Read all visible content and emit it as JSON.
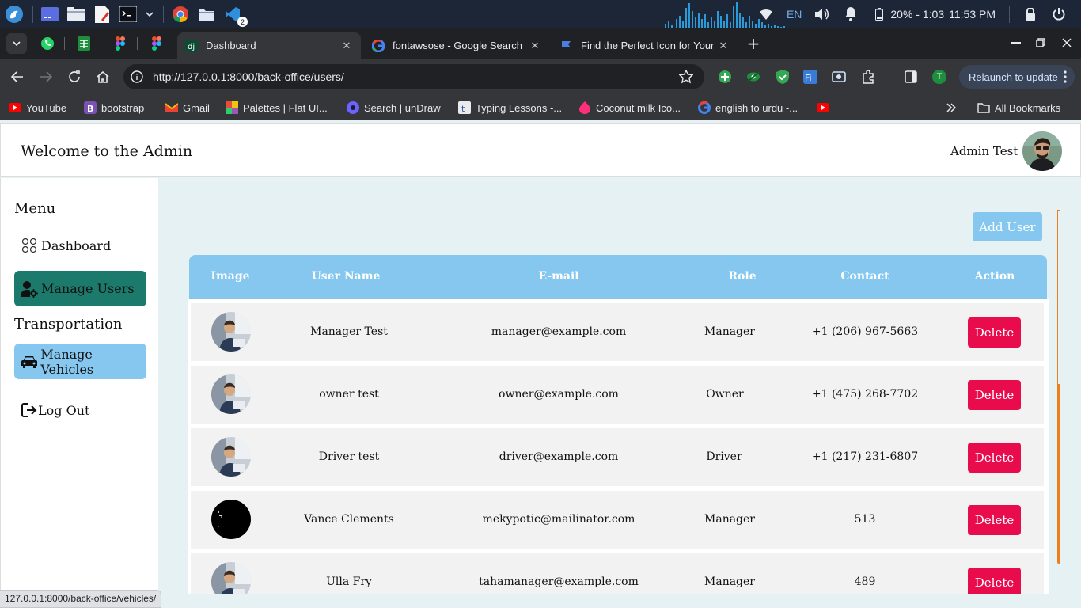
{
  "taskbar": {
    "badge": "2",
    "language": "EN",
    "battery_time": "20% - 1:03",
    "clock": "11:53 PM"
  },
  "browser": {
    "tabs": [
      {
        "title": "Dashboard",
        "active": true
      },
      {
        "title": "fontawsose - Google Search",
        "active": false
      },
      {
        "title": "Find the Perfect Icon for Your",
        "active": false
      }
    ],
    "url": "http://127.0.0.1:8000/back-office/users/",
    "relaunch_label": "Relaunch to update",
    "profile_initial": "T",
    "bookmarks": [
      "YouTube",
      "bootstrap",
      "Gmail",
      "Palettes | Flat UI...",
      "Search | unDraw",
      "Typing Lessons -...",
      "Coconut milk Ico...",
      "english to urdu -..."
    ],
    "all_bookmarks": "All Bookmarks",
    "status_url": "127.0.0.1:8000/back-office/vehicles/"
  },
  "header": {
    "welcome": "Welcome to the Admin",
    "admin_name": "Admin Test"
  },
  "sidebar": {
    "menu_heading": "Menu",
    "dashboard": "Dashboard",
    "manage_users": "Manage Users",
    "transport_heading": "Transportation",
    "manage_vehicles": "Manage Vehicles",
    "logout": "Log Out"
  },
  "main": {
    "add_user": "Add User",
    "columns": [
      "Image",
      "User Name",
      "E-mail",
      "Role",
      "Contact",
      "Action"
    ],
    "delete_label": "Delete",
    "rows": [
      {
        "name": "Manager Test",
        "email": "manager@example.com",
        "role": "Manager",
        "contact": "+1 (206) 967-5663",
        "avatar": "photo"
      },
      {
        "name": "owner test",
        "email": "owner@example.com",
        "role": "Owner",
        "contact": "+1 (475) 268-7702",
        "avatar": "photo"
      },
      {
        "name": "Driver test",
        "email": "driver@example.com",
        "role": "Driver",
        "contact": "+1 (217) 231-6807",
        "avatar": "photo"
      },
      {
        "name": "Vance Clements",
        "email": "mekypotic@mailinator.com",
        "role": "Manager",
        "contact": "513",
        "avatar": "dark"
      },
      {
        "name": "Ulla Fry",
        "email": "tahamanager@example.com",
        "role": "Manager",
        "contact": "489",
        "avatar": "photo"
      }
    ]
  },
  "colors": {
    "header_blue": "#85c7ef",
    "active_green": "#1c7a6c",
    "delete_red": "#e80c4d",
    "page_bg": "#e6f1f3",
    "scroll_orange": "#f07d1c"
  }
}
